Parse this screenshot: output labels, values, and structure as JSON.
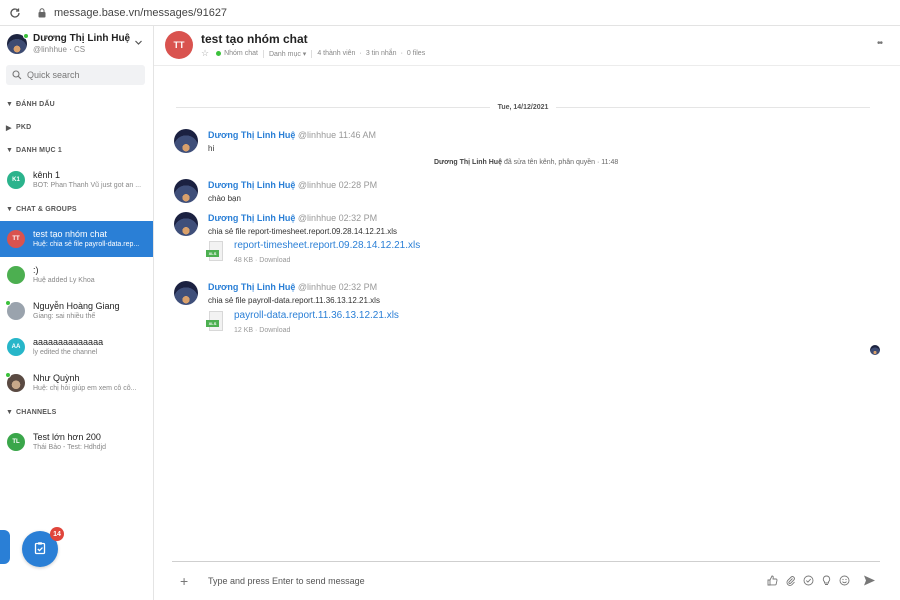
{
  "browser": {
    "url": "message.base.vn/messages/91627"
  },
  "me": {
    "name": "Dương Thị Linh Huệ",
    "handle": "@linhhue · CS"
  },
  "search": {
    "placeholder": "Quick search"
  },
  "sidebar": {
    "sections": {
      "starred": "ĐÁNH DẤU",
      "pkd": "PKD",
      "category1": "DANH MỤC 1",
      "chat_groups": "CHAT & GROUPS",
      "channels": "CHANNELS"
    },
    "category1_items": [
      {
        "initials": "K1",
        "name": "kênh 1",
        "sub": "BOT: Phan Thanh Vũ just got an ..."
      }
    ],
    "chat_items": [
      {
        "initials": "TT",
        "name": "test tạo nhóm chat",
        "sub": "Huệ: chia sẻ file payroll-data.rep..."
      },
      {
        "initials": "",
        "name": ":)",
        "sub": "Huệ added Ly Khoa"
      },
      {
        "initials": "",
        "name": "Nguyễn Hoàng Giang",
        "sub": "Giang: sai nhiều thế"
      },
      {
        "initials": "AA",
        "name": "aaaaaaaaaaaaaa",
        "sub": "ly edited the channel"
      },
      {
        "initials": "",
        "name": "Như Quỳnh",
        "sub": "Huệ: chị hỏi giúp em xem cỗ cỗ..."
      }
    ],
    "channel_items": [
      {
        "initials": "TL",
        "name": "Test lớn hơn 200",
        "sub": "Thái Bảo - Test: Hdhdjd"
      }
    ],
    "badge_count": "14"
  },
  "header": {
    "avatar": "TT",
    "title": "test tạo nhóm chat",
    "type": "Nhóm chat",
    "category": "Danh mục",
    "members": "4 thành viên",
    "messages": "3 tin nhắn",
    "files": "0 files"
  },
  "chat": {
    "date": "Tue, 14/12/2021",
    "messages": [
      {
        "author": "Dương Thị Linh Huệ",
        "handle": "@linhhue",
        "time": "11:46 AM",
        "text": "hi"
      },
      {
        "author": "Dương Thị Linh Huệ",
        "handle": "@linhhue",
        "time": "02:28 PM",
        "text": "chào bạn"
      },
      {
        "author": "Dương Thị Linh Huệ",
        "handle": "@linhhue",
        "time": "02:32 PM",
        "text": "chia sẻ file report-timesheet.report.09.28.14.12.21.xls",
        "file": {
          "name": "report-timesheet.report.09.28.14.12.21.xls",
          "meta": "48 KB · Download",
          "ext": "XLS"
        }
      },
      {
        "author": "Dương Thị Linh Huệ",
        "handle": "@linhhue",
        "time": "02:32 PM",
        "text": "chia sẻ file payroll-data.report.11.36.13.12.21.xls",
        "file": {
          "name": "payroll-data.report.11.36.13.12.21.xls",
          "meta": "12 KB · Download",
          "ext": "XLS"
        }
      }
    ],
    "system_note": {
      "actor": "Dương Thị Linh Huệ",
      "action": "đã sửa tên kênh, phân quyền · 11:48"
    }
  },
  "composer": {
    "placeholder": "Type and press Enter to send message"
  },
  "colors": {
    "accent": "#2a7fd6",
    "online": "#3bc13b",
    "badge": "#e0453b"
  }
}
